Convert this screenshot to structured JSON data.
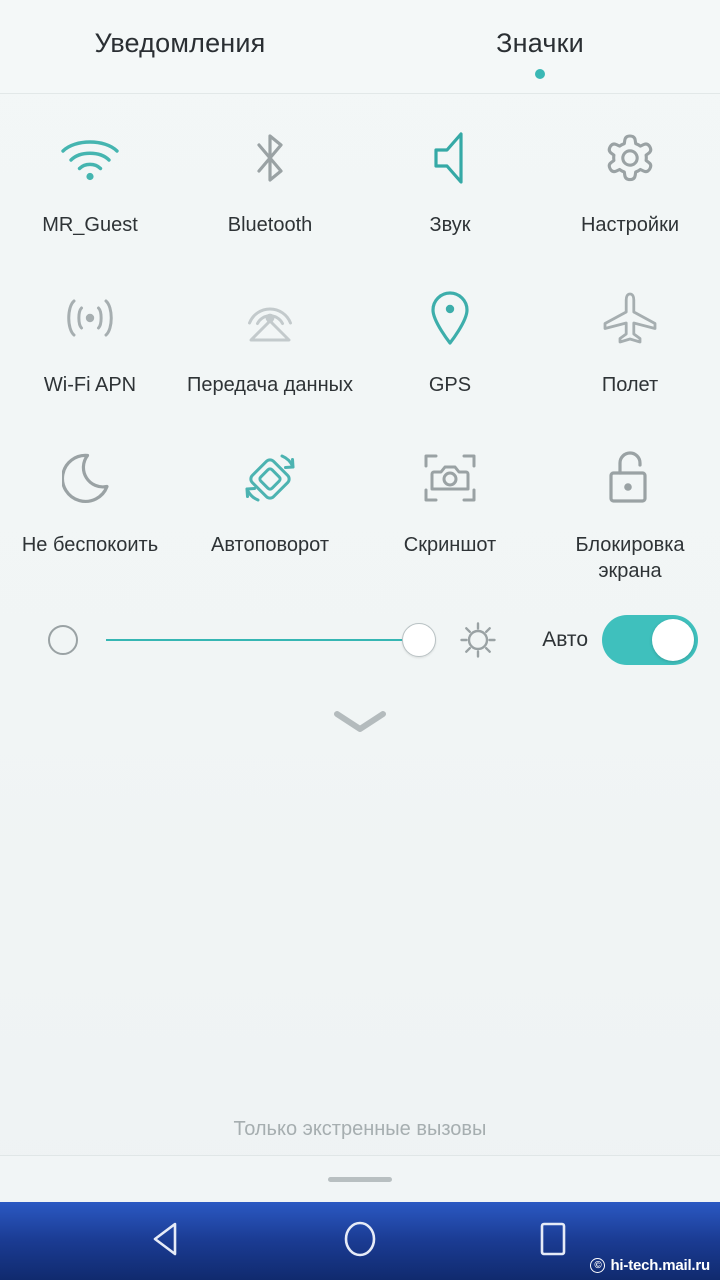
{
  "colors": {
    "accent_teal": "#3ab8b5",
    "inactive_gray": "#9aa2a4",
    "label_text": "#2e3336",
    "background": "#f2f6f6",
    "navbar_blue": "#1b3c94"
  },
  "tabs": [
    {
      "label": "Уведомления",
      "active": false
    },
    {
      "label": "Значки",
      "active": true
    }
  ],
  "tiles": [
    {
      "label": "MR_Guest",
      "icon": "wifi-icon",
      "active": true
    },
    {
      "label": "Bluetooth",
      "icon": "bluetooth-icon",
      "active": false
    },
    {
      "label": "Звук",
      "icon": "sound-icon",
      "active": true
    },
    {
      "label": "Настройки",
      "icon": "gear-icon",
      "active": false
    },
    {
      "label": "Wi-Fi APN",
      "icon": "hotspot-icon",
      "active": false
    },
    {
      "label": "Передача данных",
      "icon": "mobile-data-icon",
      "active": false
    },
    {
      "label": "GPS",
      "icon": "location-pin-icon",
      "active": true
    },
    {
      "label": "Полет",
      "icon": "airplane-icon",
      "active": false
    },
    {
      "label": "Не беспокоить",
      "icon": "moon-icon",
      "active": false
    },
    {
      "label": "Автоповорот",
      "icon": "auto-rotate-icon",
      "active": true
    },
    {
      "label": "Скриншот",
      "icon": "screenshot-icon",
      "active": false
    },
    {
      "label": "Блокировка\nэкрана",
      "icon": "unlocked-padlock-icon",
      "active": false
    }
  ],
  "brightness": {
    "low_icon": "brightness-low-icon",
    "high_icon": "brightness-high-sun-icon",
    "value_percent": 96,
    "auto_label": "Авто",
    "auto_enabled": true
  },
  "expand_handle_icon": "chevron-down-icon",
  "status": {
    "carrier_text": "Только экстренные вызовы"
  },
  "navbar": {
    "back_label": "back-triangle",
    "home_label": "home-circle",
    "recents_label": "recents-square"
  },
  "watermark": {
    "copyright": "©",
    "text": "hi-tech.mail.ru"
  }
}
